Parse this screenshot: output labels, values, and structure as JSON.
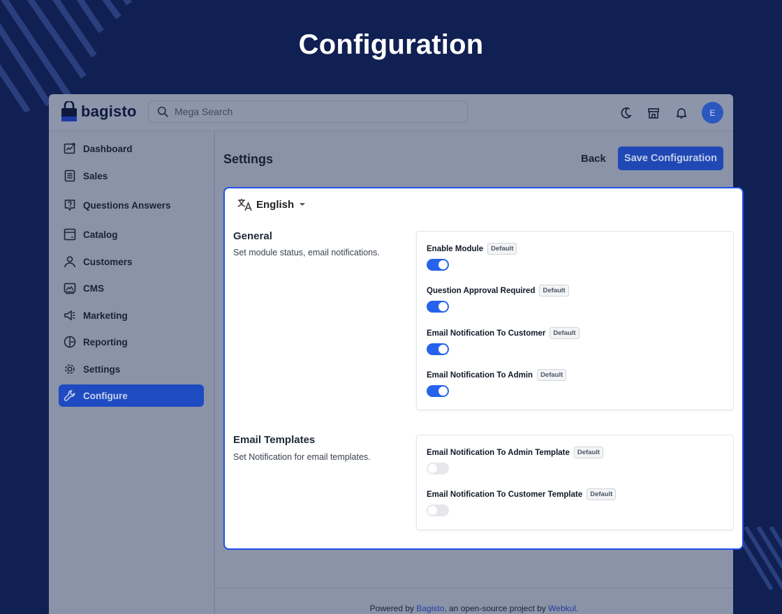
{
  "page_title": "Configuration",
  "header": {
    "logo_text": "bagisto",
    "search_placeholder": "Mega Search",
    "avatar_initial": "E",
    "icons": [
      "moon-icon",
      "store-icon",
      "bell-icon"
    ]
  },
  "sidebar": {
    "items": [
      {
        "label": "Dashboard",
        "icon": "dashboard-icon"
      },
      {
        "label": "Sales",
        "icon": "sales-icon"
      },
      {
        "label": "Questions Answers",
        "icon": "question-icon"
      },
      {
        "label": "Catalog",
        "icon": "catalog-icon"
      },
      {
        "label": "Customers",
        "icon": "customers-icon"
      },
      {
        "label": "CMS",
        "icon": "cms-icon"
      },
      {
        "label": "Marketing",
        "icon": "megaphone-icon"
      },
      {
        "label": "Reporting",
        "icon": "reporting-icon"
      },
      {
        "label": "Settings",
        "icon": "gear-icon"
      },
      {
        "label": "Configure",
        "icon": "wrench-icon",
        "active": true
      }
    ]
  },
  "main": {
    "title": "Settings",
    "back_label": "Back",
    "save_label": "Save Configuration",
    "language": "English"
  },
  "general": {
    "title": "General",
    "description": "Set module status, email notifications.",
    "fields": [
      {
        "label": "Enable Module",
        "badge": "Default",
        "enabled": true
      },
      {
        "label": "Question Approval Required",
        "badge": "Default",
        "enabled": true
      },
      {
        "label": "Email Notification To Customer",
        "badge": "Default",
        "enabled": true
      },
      {
        "label": "Email Notification To Admin",
        "badge": "Default",
        "enabled": true
      }
    ]
  },
  "email_templates": {
    "title": "Email Templates",
    "description": "Set Notification for email templates.",
    "fields": [
      {
        "label": "Email Notification To Admin Template",
        "badge": "Default",
        "enabled": false
      },
      {
        "label": "Email Notification To Customer Template",
        "badge": "Default",
        "enabled": false
      }
    ]
  },
  "footer": {
    "prefix": "Powered by ",
    "link1": "Bagisto",
    "middle": ", an open-source project by ",
    "link2": "Webkul",
    "suffix": "."
  },
  "colors": {
    "background": "#112052",
    "accent": "#2563eb",
    "panel_border": "#2050e6"
  }
}
